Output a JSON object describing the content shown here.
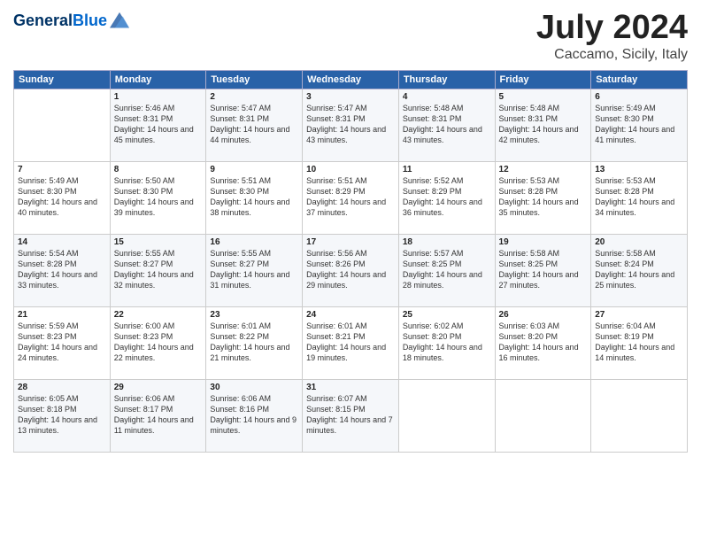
{
  "header": {
    "logo_line1": "General",
    "logo_line2": "Blue",
    "month_title": "July 2024",
    "location": "Caccamo, Sicily, Italy"
  },
  "days_of_week": [
    "Sunday",
    "Monday",
    "Tuesday",
    "Wednesday",
    "Thursday",
    "Friday",
    "Saturday"
  ],
  "weeks": [
    [
      {
        "day": "",
        "sunrise": "",
        "sunset": "",
        "daylight": ""
      },
      {
        "day": "1",
        "sunrise": "5:46 AM",
        "sunset": "8:31 PM",
        "daylight": "14 hours and 45 minutes."
      },
      {
        "day": "2",
        "sunrise": "5:47 AM",
        "sunset": "8:31 PM",
        "daylight": "14 hours and 44 minutes."
      },
      {
        "day": "3",
        "sunrise": "5:47 AM",
        "sunset": "8:31 PM",
        "daylight": "14 hours and 43 minutes."
      },
      {
        "day": "4",
        "sunrise": "5:48 AM",
        "sunset": "8:31 PM",
        "daylight": "14 hours and 43 minutes."
      },
      {
        "day": "5",
        "sunrise": "5:48 AM",
        "sunset": "8:31 PM",
        "daylight": "14 hours and 42 minutes."
      },
      {
        "day": "6",
        "sunrise": "5:49 AM",
        "sunset": "8:30 PM",
        "daylight": "14 hours and 41 minutes."
      }
    ],
    [
      {
        "day": "7",
        "sunrise": "5:49 AM",
        "sunset": "8:30 PM",
        "daylight": "14 hours and 40 minutes."
      },
      {
        "day": "8",
        "sunrise": "5:50 AM",
        "sunset": "8:30 PM",
        "daylight": "14 hours and 39 minutes."
      },
      {
        "day": "9",
        "sunrise": "5:51 AM",
        "sunset": "8:30 PM",
        "daylight": "14 hours and 38 minutes."
      },
      {
        "day": "10",
        "sunrise": "5:51 AM",
        "sunset": "8:29 PM",
        "daylight": "14 hours and 37 minutes."
      },
      {
        "day": "11",
        "sunrise": "5:52 AM",
        "sunset": "8:29 PM",
        "daylight": "14 hours and 36 minutes."
      },
      {
        "day": "12",
        "sunrise": "5:53 AM",
        "sunset": "8:28 PM",
        "daylight": "14 hours and 35 minutes."
      },
      {
        "day": "13",
        "sunrise": "5:53 AM",
        "sunset": "8:28 PM",
        "daylight": "14 hours and 34 minutes."
      }
    ],
    [
      {
        "day": "14",
        "sunrise": "5:54 AM",
        "sunset": "8:28 PM",
        "daylight": "14 hours and 33 minutes."
      },
      {
        "day": "15",
        "sunrise": "5:55 AM",
        "sunset": "8:27 PM",
        "daylight": "14 hours and 32 minutes."
      },
      {
        "day": "16",
        "sunrise": "5:55 AM",
        "sunset": "8:27 PM",
        "daylight": "14 hours and 31 minutes."
      },
      {
        "day": "17",
        "sunrise": "5:56 AM",
        "sunset": "8:26 PM",
        "daylight": "14 hours and 29 minutes."
      },
      {
        "day": "18",
        "sunrise": "5:57 AM",
        "sunset": "8:25 PM",
        "daylight": "14 hours and 28 minutes."
      },
      {
        "day": "19",
        "sunrise": "5:58 AM",
        "sunset": "8:25 PM",
        "daylight": "14 hours and 27 minutes."
      },
      {
        "day": "20",
        "sunrise": "5:58 AM",
        "sunset": "8:24 PM",
        "daylight": "14 hours and 25 minutes."
      }
    ],
    [
      {
        "day": "21",
        "sunrise": "5:59 AM",
        "sunset": "8:23 PM",
        "daylight": "14 hours and 24 minutes."
      },
      {
        "day": "22",
        "sunrise": "6:00 AM",
        "sunset": "8:23 PM",
        "daylight": "14 hours and 22 minutes."
      },
      {
        "day": "23",
        "sunrise": "6:01 AM",
        "sunset": "8:22 PM",
        "daylight": "14 hours and 21 minutes."
      },
      {
        "day": "24",
        "sunrise": "6:01 AM",
        "sunset": "8:21 PM",
        "daylight": "14 hours and 19 minutes."
      },
      {
        "day": "25",
        "sunrise": "6:02 AM",
        "sunset": "8:20 PM",
        "daylight": "14 hours and 18 minutes."
      },
      {
        "day": "26",
        "sunrise": "6:03 AM",
        "sunset": "8:20 PM",
        "daylight": "14 hours and 16 minutes."
      },
      {
        "day": "27",
        "sunrise": "6:04 AM",
        "sunset": "8:19 PM",
        "daylight": "14 hours and 14 minutes."
      }
    ],
    [
      {
        "day": "28",
        "sunrise": "6:05 AM",
        "sunset": "8:18 PM",
        "daylight": "14 hours and 13 minutes."
      },
      {
        "day": "29",
        "sunrise": "6:06 AM",
        "sunset": "8:17 PM",
        "daylight": "14 hours and 11 minutes."
      },
      {
        "day": "30",
        "sunrise": "6:06 AM",
        "sunset": "8:16 PM",
        "daylight": "14 hours and 9 minutes."
      },
      {
        "day": "31",
        "sunrise": "6:07 AM",
        "sunset": "8:15 PM",
        "daylight": "14 hours and 7 minutes."
      },
      {
        "day": "",
        "sunrise": "",
        "sunset": "",
        "daylight": ""
      },
      {
        "day": "",
        "sunrise": "",
        "sunset": "",
        "daylight": ""
      },
      {
        "day": "",
        "sunrise": "",
        "sunset": "",
        "daylight": ""
      }
    ]
  ]
}
